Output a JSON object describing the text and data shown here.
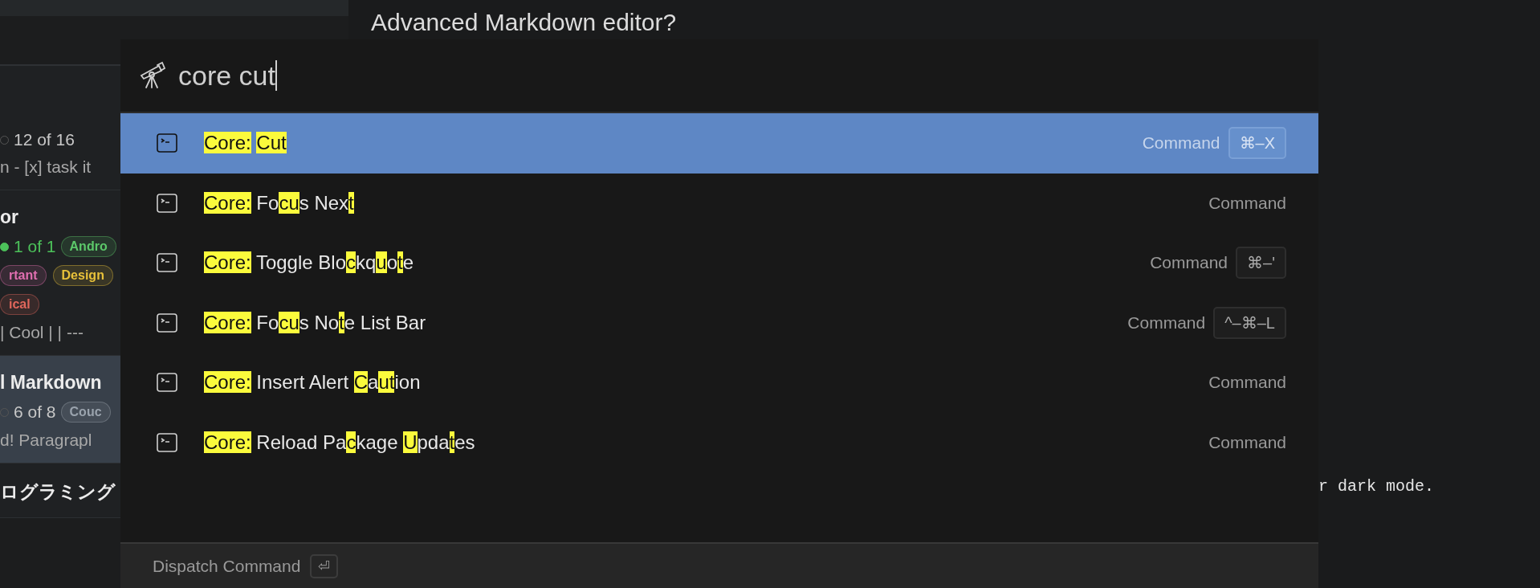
{
  "notes": [
    {
      "selected": false,
      "parts": [
        {
          "kind": "count",
          "done": false,
          "text": "12 of 16"
        },
        {
          "kind": "excerpt",
          "text": "n - [x] task it"
        }
      ]
    },
    {
      "selected": false,
      "parts": [
        {
          "kind": "title",
          "text": "or"
        },
        {
          "kind": "count",
          "done": true,
          "text": "1 of 1",
          "tags": [
            {
              "text": "Andro",
              "color": "#5cc86a"
            }
          ]
        },
        {
          "kind": "tags",
          "tags": [
            {
              "text": "rtant",
              "color": "#e06fb0"
            },
            {
              "text": "Design",
              "color": "#e8c13a"
            }
          ]
        },
        {
          "kind": "tags",
          "tags": [
            {
              "text": "ical",
              "color": "#e0675c"
            }
          ]
        },
        {
          "kind": "excerpt",
          "text": "| Cool | | ---"
        }
      ]
    },
    {
      "selected": true,
      "parts": [
        {
          "kind": "title",
          "text": "l Markdown"
        },
        {
          "kind": "count",
          "done": false,
          "text": "6 of 8",
          "tags": [
            {
              "text": "Couc",
              "color": "#9aa3ad"
            }
          ]
        },
        {
          "kind": "excerpt",
          "text": "d! Paragrapl"
        }
      ]
    },
    {
      "selected": false,
      "parts": [
        {
          "kind": "title",
          "text": "ログラミング"
        }
      ]
    }
  ],
  "editor": {
    "title": "Advanced Markdown editor?",
    "code_line": "r dark mode."
  },
  "palette": {
    "query": "core cut",
    "results": [
      {
        "selected": true,
        "segments": [
          {
            "text": "Core:",
            "hl": true
          },
          {
            "text": " Cut",
            "hl": true
          }
        ],
        "category": "Command",
        "shortcut": "⌘–X"
      },
      {
        "selected": false,
        "segments": [
          {
            "text": "Core:",
            "hl": true
          },
          {
            "text": " Fo",
            "hl": false
          },
          {
            "text": "cu",
            "hl": true
          },
          {
            "text": "s Nex",
            "hl": false
          },
          {
            "text": "t",
            "hl": true
          }
        ],
        "category": "Command"
      },
      {
        "selected": false,
        "segments": [
          {
            "text": "Core:",
            "hl": true
          },
          {
            "text": " Toggle Blo",
            "hl": false
          },
          {
            "text": "c",
            "hl": true
          },
          {
            "text": "kq",
            "hl": false
          },
          {
            "text": "u",
            "hl": true
          },
          {
            "text": "o",
            "hl": false
          },
          {
            "text": "t",
            "hl": true
          },
          {
            "text": "e",
            "hl": false
          }
        ],
        "category": "Command",
        "shortcut": "⌘–'"
      },
      {
        "selected": false,
        "segments": [
          {
            "text": "Core:",
            "hl": true
          },
          {
            "text": " Fo",
            "hl": false
          },
          {
            "text": "cu",
            "hl": true
          },
          {
            "text": "s No",
            "hl": false
          },
          {
            "text": "t",
            "hl": true
          },
          {
            "text": "e List Bar",
            "hl": false
          }
        ],
        "category": "Command",
        "shortcut": "^–⌘–L"
      },
      {
        "selected": false,
        "segments": [
          {
            "text": "Core:",
            "hl": true
          },
          {
            "text": " Insert Alert ",
            "hl": false
          },
          {
            "text": "C",
            "hl": true
          },
          {
            "text": "a",
            "hl": false
          },
          {
            "text": "ut",
            "hl": true
          },
          {
            "text": "ion",
            "hl": false
          }
        ],
        "category": "Command"
      },
      {
        "selected": false,
        "segments": [
          {
            "text": "Core:",
            "hl": true
          },
          {
            "text": " Reload Pa",
            "hl": false
          },
          {
            "text": "c",
            "hl": true
          },
          {
            "text": "kage ",
            "hl": false
          },
          {
            "text": "U",
            "hl": true
          },
          {
            "text": "pda",
            "hl": false
          },
          {
            "text": "t",
            "hl": true
          },
          {
            "text": "es",
            "hl": false
          }
        ],
        "category": "Command"
      }
    ],
    "footer": {
      "label": "Dispatch Command",
      "key": "⏎"
    }
  }
}
